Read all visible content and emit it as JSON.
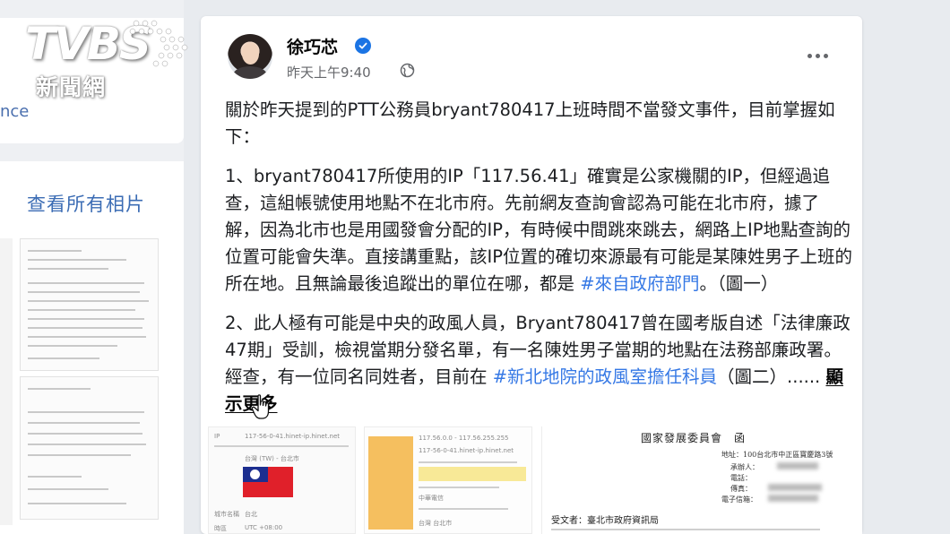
{
  "broadcast": {
    "logo_main": "TVBS",
    "logo_sub": "新聞網"
  },
  "sidebar": {
    "fragment_text": "nce",
    "see_all_photos": "查看所有相片"
  },
  "post": {
    "author": "徐巧芯",
    "verified": true,
    "timestamp": "昨天上午9:40",
    "privacy_icon": "globe-icon",
    "more_icon": "more-options-icon",
    "intro": "關於昨天提到的PTT公務員bryant780417上班時間不當發文事件，目前掌握如下：",
    "para1_text": "1、bryant780417所使用的IP「117.56.41」確實是公家機關的IP，但經過追查，這組帳號使用地點不在北市府。先前網友查詢會認為可能在北市府，據了解，因為北市也是用國發會分配的IP，有時候中間跳來跳去，網路上IP地點查詢的位置可能會失準。直接講重點，該IP位置的確切來源最有可能是某陳姓男子上班的所在地。且無論最後追蹤出的單位在哪，都是 ",
    "para1_tag": "#來自政府部門",
    "para1_tail": "。（圖一）",
    "para2_text": "2、此人極有可能是中央的政風人員，Bryant780417曾在國考版自述「法律廉政47期」受訓，檢視當期分發名單，有一名陳姓男子當期的地點在法務部廉政署。經查，有一位同名同姓者，目前在 ",
    "para2_tag": "#新北地院的政風室擔任科員",
    "para2_tail": "（圖二）...... ",
    "see_more": "顯示更多",
    "accent_color": "#3578e5"
  },
  "attachments": {
    "img1": {
      "host": "117-56-0-41.hinet-ip.hinet.net",
      "country": "台灣 (TW) - 台北市",
      "label_a": "城市名稱",
      "value_a": "台北",
      "label_b": "時區",
      "value_b": "UTC +08:00"
    },
    "img2": {
      "line1": "117.56.0.0 - 117.56.255.255",
      "line2": "117-56-0-41.hinet-ip.hinet.net",
      "line3": "中華電信",
      "line4": "台灣 台北市"
    },
    "img3": {
      "title": "國家發展委員會　函",
      "address": "地址：100台北市中正區寶慶路3號",
      "contact": "承辦人：",
      "phone": "電話：",
      "fax": "傳真：",
      "email": "電子信箱：",
      "recipient": "受文者：臺北市政府資訊局"
    }
  }
}
